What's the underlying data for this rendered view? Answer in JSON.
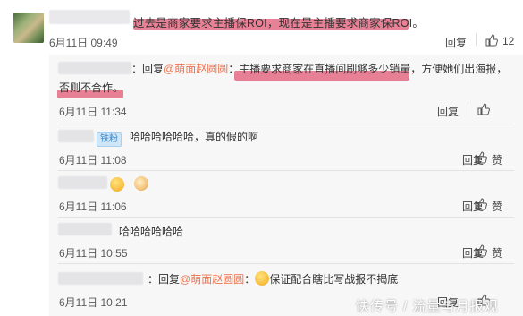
{
  "main_comment": {
    "text": "过去是商家要求主播保ROI，现在是主播要求商家保ROI。",
    "time": "6月11日 09:49",
    "reply_label": "回复",
    "like_count": "12"
  },
  "replies": [
    {
      "prefix": "：回复",
      "mention": "@萌面赵圆圆",
      "text_line1": "：主播要求商家在直播间刷够多少销量，方便她们出海报，",
      "text_line2": "否则不合作。",
      "time": "6月11日 11:34",
      "reply_label": "回复"
    },
    {
      "badge": "铁粉",
      "text": "哈哈哈哈哈哈，真的假的啊",
      "time": "6月11日 11:08",
      "reply_label": "回复",
      "like_label": "赞"
    },
    {
      "text": "",
      "time": "6月11日 11:06",
      "reply_label": "回复",
      "like_label": "赞"
    },
    {
      "text": "哈哈哈哈哈哈",
      "time": "6月11日 10:55",
      "reply_label": "回复",
      "like_label": "赞"
    },
    {
      "prefix": "：回复",
      "mention": "@萌面赵圆圆",
      "text": "保证配合瞎比写战报不揭底",
      "time": "6月11日 10:21",
      "reply_label": "回复"
    }
  ],
  "watermark": "快传号 / 流量与月报观"
}
